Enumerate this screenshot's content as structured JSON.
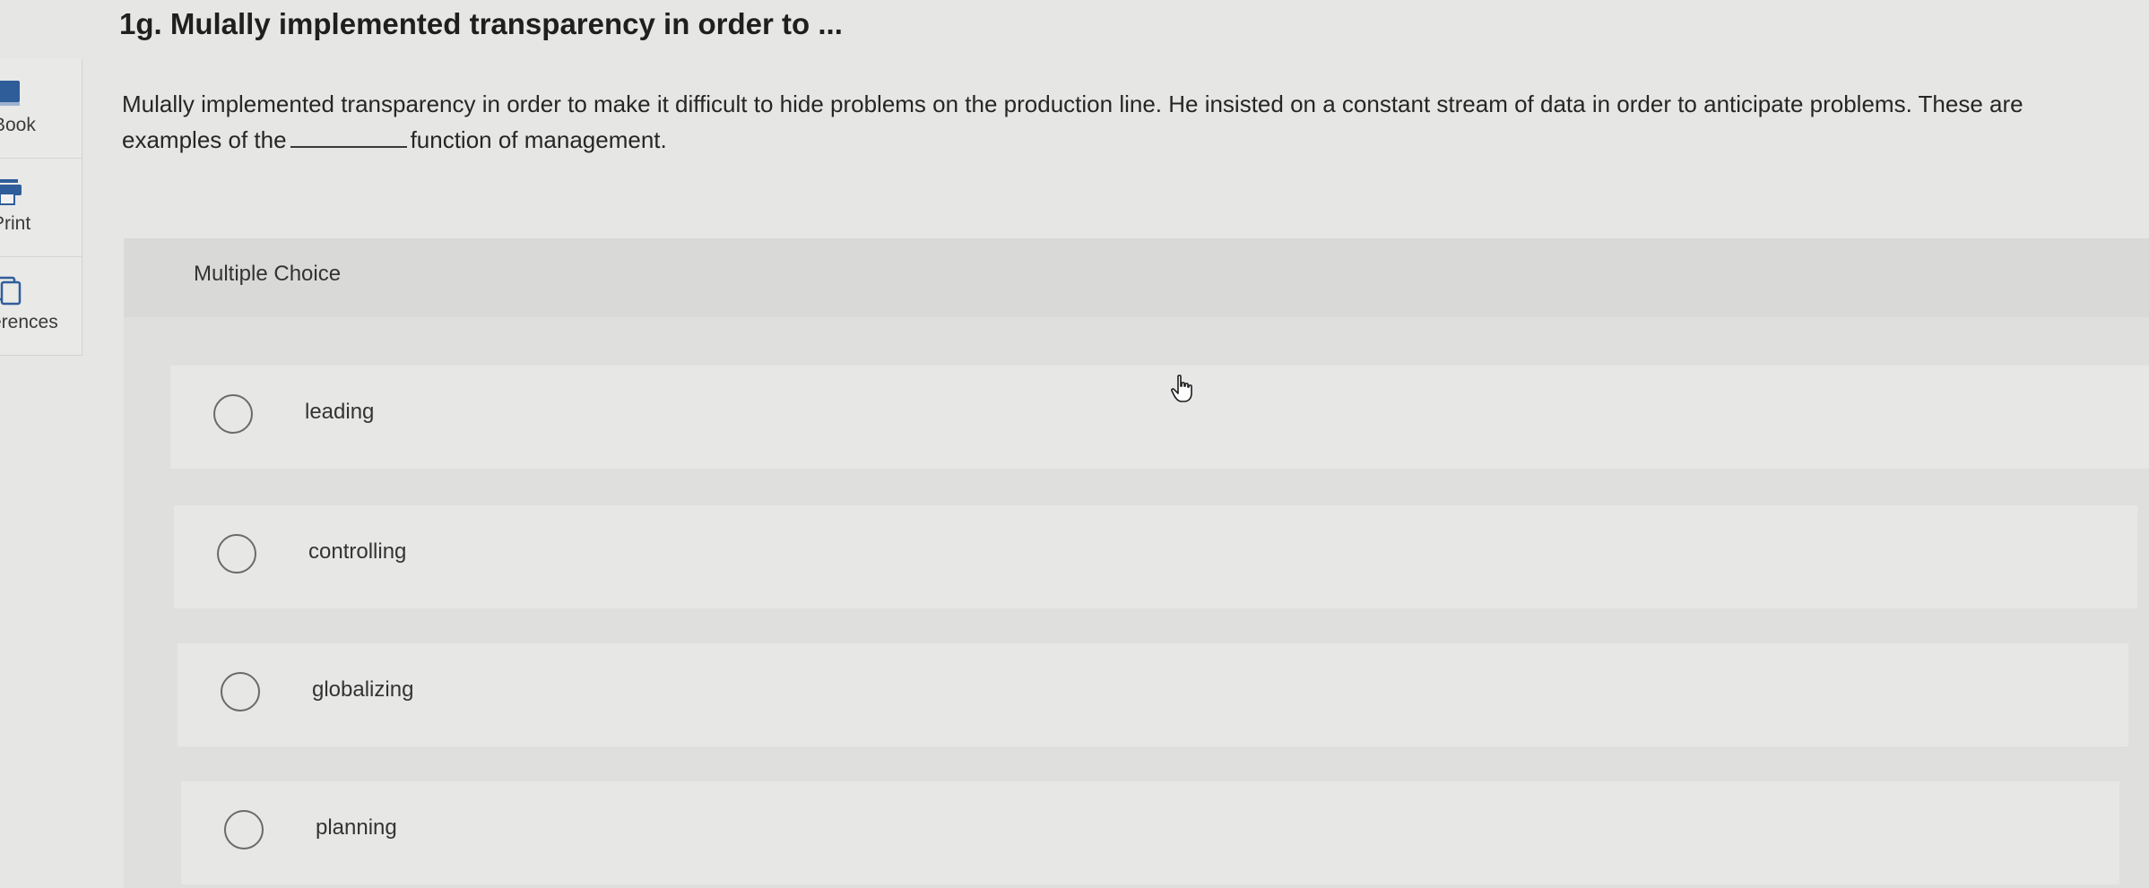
{
  "sidebar": {
    "items": [
      {
        "label": "Book",
        "icon": "book-icon"
      },
      {
        "label": "Print",
        "icon": "print-icon"
      },
      {
        "label": "erences",
        "icon": "references-icon"
      }
    ]
  },
  "question": {
    "title": "1g. Mulally implemented transparency in order to ...",
    "text_line1": "Mulally implemented transparency in order to make it difficult to hide problems on the production line. He insisted on a constant stream of data in order to anticipate problems. These are",
    "text_line2_before": "examples of the",
    "text_line2_after": "function of management."
  },
  "multiple_choice": {
    "label": "Multiple Choice",
    "options": [
      {
        "label": "leading"
      },
      {
        "label": "controlling"
      },
      {
        "label": "globalizing"
      },
      {
        "label": "planning"
      }
    ]
  },
  "colors": {
    "background": "#e6e6e4",
    "option_background": "#e7e7e6",
    "accent_icon": "#2f5d9a"
  }
}
